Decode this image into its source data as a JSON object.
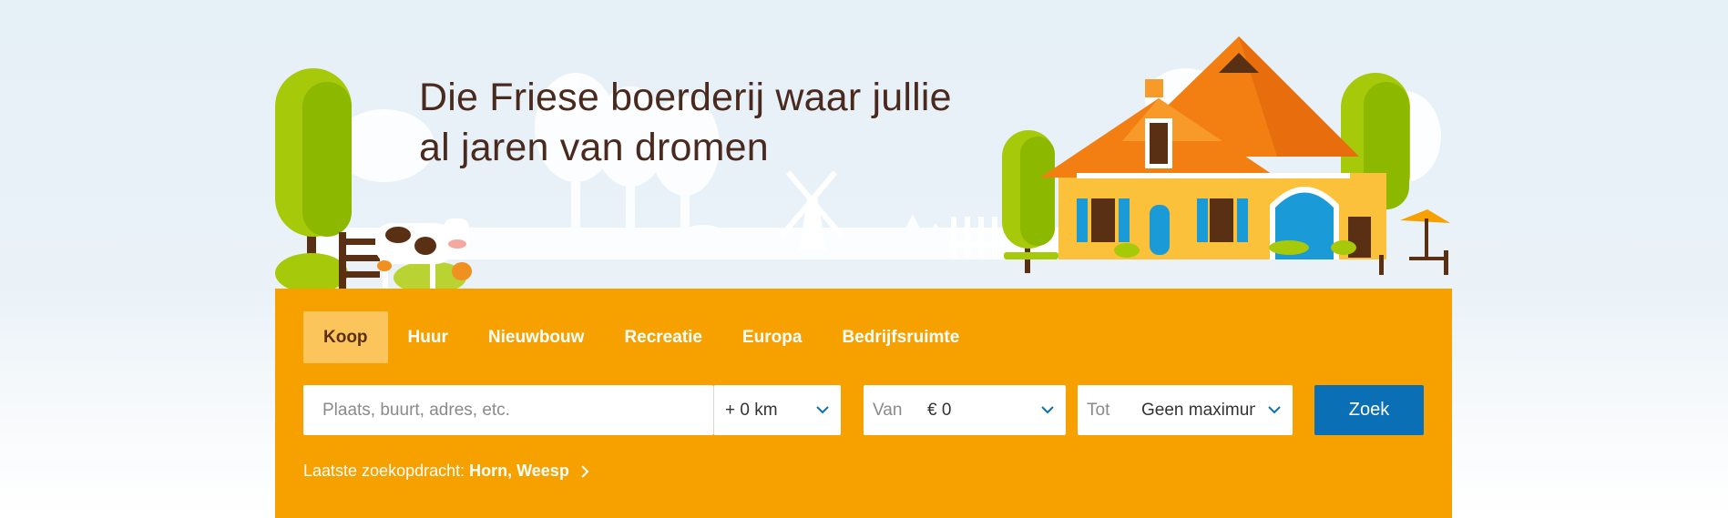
{
  "hero": {
    "headline_line1": "Die Friese boerderij waar jullie",
    "headline_line2": "al jaren van dromen"
  },
  "tabs": [
    {
      "label": "Koop",
      "active": true
    },
    {
      "label": "Huur"
    },
    {
      "label": "Nieuwbouw"
    },
    {
      "label": "Recreatie"
    },
    {
      "label": "Europa"
    },
    {
      "label": "Bedrijfsruimte"
    }
  ],
  "search": {
    "location_placeholder": "Plaats, buurt, adres, etc.",
    "radius_value": "+ 0 km",
    "price_from_label": "Van",
    "price_from_value": "€ 0",
    "price_to_label": "Tot",
    "price_to_value": "Geen maximum",
    "submit_label": "Zoek"
  },
  "last_search": {
    "label": "Laatste zoekopdracht:",
    "value": "Horn, Weesp"
  },
  "colors": {
    "panel": "#f7a100",
    "active_tab": "#fcc55c",
    "button": "#0a6fb4",
    "headline": "#4a2a1e"
  }
}
